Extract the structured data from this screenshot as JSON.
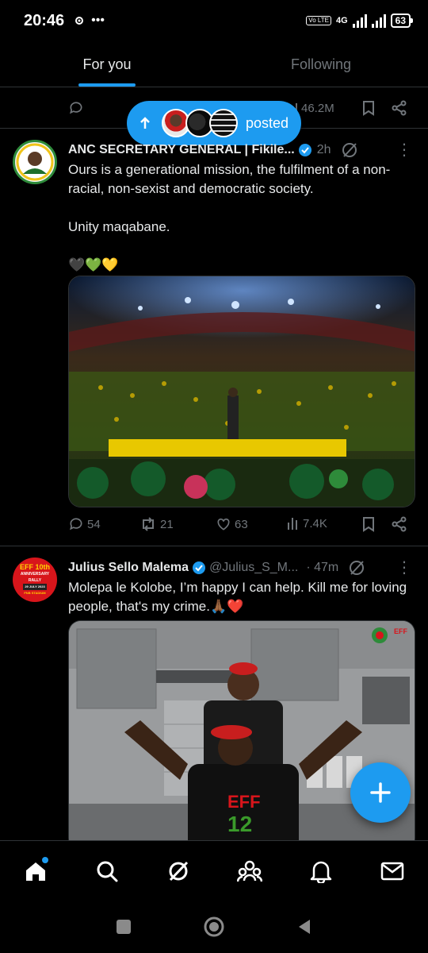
{
  "status_bar": {
    "time": "20:46",
    "network_label": "4G",
    "volte_label": "Vo LTE",
    "battery": "63"
  },
  "tabs": [
    {
      "label": "For you",
      "active": true
    },
    {
      "label": "Following",
      "active": false
    }
  ],
  "prev_tweet": {
    "views": "46.2M"
  },
  "posted_pill": {
    "label": "posted"
  },
  "tweets": [
    {
      "name": "ANC SECRETARY GENERAL | Fikile...",
      "handle": "",
      "time": "2h",
      "text": "Ours is a generational mission, the fulfilment of a non-racial, non-sexist and democratic society.\n\nUnity maqabane.\n\n🖤💚💛",
      "stats": {
        "replies": "54",
        "reposts": "21",
        "likes": "63",
        "views": "7.4K"
      }
    },
    {
      "name": "Julius Sello Malema",
      "handle": "@Julius_S_M...",
      "time": "· 47m",
      "text": "Molepa le Kolobe, I’m happy I can help. Kill me for loving people, that's my crime.🙏🏾❤️",
      "avatar_lines": [
        "EFF 10th",
        "ANNIVERSARY",
        "RALLY",
        "29 JULY 2023",
        "FNB STADIUM"
      ],
      "media_logo": "EFF"
    }
  ],
  "colors": {
    "accent": "#1d9bf0",
    "background": "#000000",
    "text": "#e7e9ea",
    "muted": "#71767b"
  },
  "icons": {
    "nav": [
      "home-icon",
      "search-icon",
      "grok-icon",
      "communities-icon",
      "notifications-icon",
      "messages-icon"
    ],
    "system": [
      "recents-icon",
      "home-circle-icon",
      "back-icon"
    ]
  }
}
